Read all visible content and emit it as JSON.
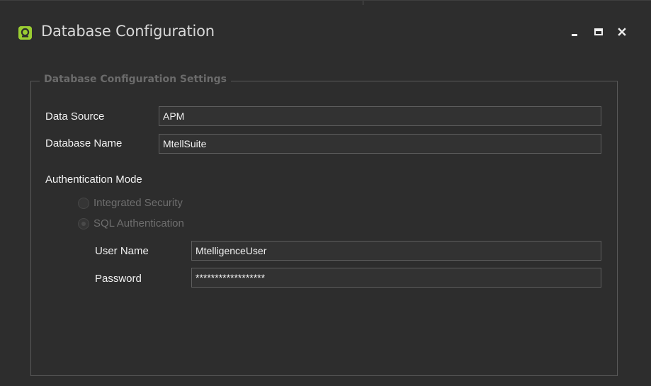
{
  "window": {
    "title": "Database Configuration",
    "controls": {
      "minimize": "minimize-icon",
      "maximize": "maximize-icon",
      "close": "close-icon"
    },
    "accent_color": "#9acd32"
  },
  "settings_group": {
    "legend": "Database Configuration Settings",
    "data_source": {
      "label": "Data Source",
      "value": "APM"
    },
    "database_name": {
      "label": "Database Name",
      "value": "MtellSuite"
    },
    "authentication": {
      "label": "Authentication Mode",
      "options": [
        {
          "label": "Integrated Security",
          "selected": false,
          "enabled": false
        },
        {
          "label": "SQL Authentication",
          "selected": true,
          "enabled": false
        }
      ],
      "user_name": {
        "label": "User Name",
        "value": "MtelligenceUser"
      },
      "password": {
        "label": "Password",
        "value": "******************"
      }
    }
  }
}
